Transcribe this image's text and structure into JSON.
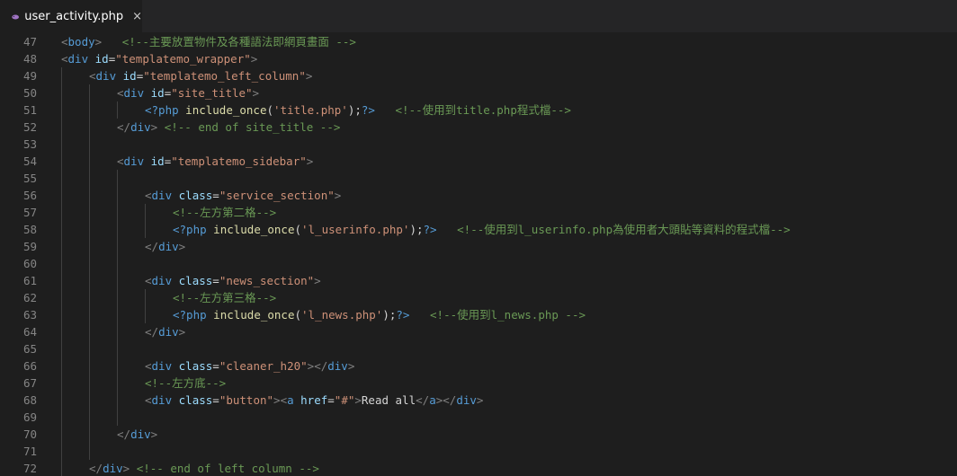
{
  "tab": {
    "filename": "user_activity.php",
    "close_glyph": "×",
    "icon": "php-elephant-icon",
    "icon_color": "#a074c4"
  },
  "colors": {
    "background": "#1e1e1e",
    "tag": "#569cd6",
    "attribute": "#9cdcfe",
    "string": "#ce9178",
    "comment": "#6a9955",
    "line_number": "#858585"
  },
  "lines": [
    {
      "n": "47",
      "indent": 0,
      "tokens": [
        [
          "p",
          "<"
        ],
        [
          "t",
          "body"
        ],
        [
          "p",
          ">"
        ],
        [
          "w",
          "   "
        ],
        [
          "c",
          "<!--主要放置物件及各種語法即網頁畫面 -->"
        ]
      ]
    },
    {
      "n": "48",
      "indent": 0,
      "tokens": [
        [
          "p",
          "<"
        ],
        [
          "t",
          "div"
        ],
        [
          "w",
          " "
        ],
        [
          "a",
          "id"
        ],
        [
          "w",
          "="
        ],
        [
          "s",
          "\"templatemo_wrapper\""
        ],
        [
          "p",
          ">"
        ]
      ]
    },
    {
      "n": "49",
      "indent": 1,
      "tokens": [
        [
          "p",
          "<"
        ],
        [
          "t",
          "div"
        ],
        [
          "w",
          " "
        ],
        [
          "a",
          "id"
        ],
        [
          "w",
          "="
        ],
        [
          "s",
          "\"templatemo_left_column\""
        ],
        [
          "p",
          ">"
        ]
      ]
    },
    {
      "n": "50",
      "indent": 2,
      "tokens": [
        [
          "p",
          "<"
        ],
        [
          "t",
          "div"
        ],
        [
          "w",
          " "
        ],
        [
          "a",
          "id"
        ],
        [
          "w",
          "="
        ],
        [
          "s",
          "\"site_title\""
        ],
        [
          "p",
          ">"
        ]
      ]
    },
    {
      "n": "51",
      "indent": 3,
      "tokens": [
        [
          "k",
          "<?php"
        ],
        [
          "w",
          " "
        ],
        [
          "f",
          "include_once"
        ],
        [
          "w",
          "("
        ],
        [
          "s",
          "'title.php'"
        ],
        [
          "w",
          ");"
        ],
        [
          "k",
          "?>"
        ],
        [
          "w",
          "   "
        ],
        [
          "c",
          "<!--使用到title.php程式檔-->"
        ]
      ]
    },
    {
      "n": "52",
      "indent": 2,
      "tokens": [
        [
          "p",
          "</"
        ],
        [
          "t",
          "div"
        ],
        [
          "p",
          ">"
        ],
        [
          "w",
          " "
        ],
        [
          "c",
          "<!-- end of site_title -->"
        ]
      ]
    },
    {
      "n": "53",
      "indent": 2,
      "tokens": []
    },
    {
      "n": "54",
      "indent": 2,
      "tokens": [
        [
          "p",
          "<"
        ],
        [
          "t",
          "div"
        ],
        [
          "w",
          " "
        ],
        [
          "a",
          "id"
        ],
        [
          "w",
          "="
        ],
        [
          "s",
          "\"templatemo_sidebar\""
        ],
        [
          "p",
          ">"
        ]
      ]
    },
    {
      "n": "55",
      "indent": 3,
      "tokens": []
    },
    {
      "n": "56",
      "indent": 3,
      "tokens": [
        [
          "p",
          "<"
        ],
        [
          "t",
          "div"
        ],
        [
          "w",
          " "
        ],
        [
          "a",
          "class"
        ],
        [
          "w",
          "="
        ],
        [
          "s",
          "\"service_section\""
        ],
        [
          "p",
          ">"
        ]
      ]
    },
    {
      "n": "57",
      "indent": 4,
      "tokens": [
        [
          "c",
          "<!--左方第二格-->"
        ]
      ]
    },
    {
      "n": "58",
      "indent": 4,
      "tokens": [
        [
          "k",
          "<?php"
        ],
        [
          "w",
          " "
        ],
        [
          "f",
          "include_once"
        ],
        [
          "w",
          "("
        ],
        [
          "s",
          "'l_userinfo.php'"
        ],
        [
          "w",
          ");"
        ],
        [
          "k",
          "?>"
        ],
        [
          "w",
          "   "
        ],
        [
          "c",
          "<!--使用到l_userinfo.php為使用者大頭貼等資料的程式檔-->"
        ]
      ]
    },
    {
      "n": "59",
      "indent": 3,
      "tokens": [
        [
          "p",
          "</"
        ],
        [
          "t",
          "div"
        ],
        [
          "p",
          ">"
        ]
      ]
    },
    {
      "n": "60",
      "indent": 3,
      "tokens": []
    },
    {
      "n": "61",
      "indent": 3,
      "tokens": [
        [
          "p",
          "<"
        ],
        [
          "t",
          "div"
        ],
        [
          "w",
          " "
        ],
        [
          "a",
          "class"
        ],
        [
          "w",
          "="
        ],
        [
          "s",
          "\"news_section\""
        ],
        [
          "p",
          ">"
        ]
      ]
    },
    {
      "n": "62",
      "indent": 4,
      "tokens": [
        [
          "c",
          "<!--左方第三格-->"
        ]
      ]
    },
    {
      "n": "63",
      "indent": 4,
      "tokens": [
        [
          "k",
          "<?php"
        ],
        [
          "w",
          " "
        ],
        [
          "f",
          "include_once"
        ],
        [
          "w",
          "("
        ],
        [
          "s",
          "'l_news.php'"
        ],
        [
          "w",
          ");"
        ],
        [
          "k",
          "?>"
        ],
        [
          "w",
          "   "
        ],
        [
          "c",
          "<!--使用到l_news.php -->"
        ]
      ]
    },
    {
      "n": "64",
      "indent": 3,
      "tokens": [
        [
          "p",
          "</"
        ],
        [
          "t",
          "div"
        ],
        [
          "p",
          ">"
        ]
      ]
    },
    {
      "n": "65",
      "indent": 3,
      "tokens": []
    },
    {
      "n": "66",
      "indent": 3,
      "tokens": [
        [
          "p",
          "<"
        ],
        [
          "t",
          "div"
        ],
        [
          "w",
          " "
        ],
        [
          "a",
          "class"
        ],
        [
          "w",
          "="
        ],
        [
          "s",
          "\"cleaner_h20\""
        ],
        [
          "p",
          ">"
        ],
        [
          "p",
          "</"
        ],
        [
          "t",
          "div"
        ],
        [
          "p",
          ">"
        ]
      ]
    },
    {
      "n": "67",
      "indent": 3,
      "tokens": [
        [
          "c",
          "<!--左方底-->"
        ]
      ]
    },
    {
      "n": "68",
      "indent": 3,
      "tokens": [
        [
          "p",
          "<"
        ],
        [
          "t",
          "div"
        ],
        [
          "w",
          " "
        ],
        [
          "a",
          "class"
        ],
        [
          "w",
          "="
        ],
        [
          "s",
          "\"button\""
        ],
        [
          "p",
          ">"
        ],
        [
          "p",
          "<"
        ],
        [
          "t",
          "a"
        ],
        [
          "w",
          " "
        ],
        [
          "a",
          "href"
        ],
        [
          "w",
          "="
        ],
        [
          "s",
          "\"#\""
        ],
        [
          "p",
          ">"
        ],
        [
          "w",
          "Read all"
        ],
        [
          "p",
          "</"
        ],
        [
          "t",
          "a"
        ],
        [
          "p",
          ">"
        ],
        [
          "p",
          "</"
        ],
        [
          "t",
          "div"
        ],
        [
          "p",
          ">"
        ]
      ]
    },
    {
      "n": "69",
      "indent": 3,
      "tokens": []
    },
    {
      "n": "70",
      "indent": 2,
      "tokens": [
        [
          "p",
          "</"
        ],
        [
          "t",
          "div"
        ],
        [
          "p",
          ">"
        ]
      ]
    },
    {
      "n": "71",
      "indent": 2,
      "tokens": []
    },
    {
      "n": "72",
      "indent": 1,
      "tokens": [
        [
          "p",
          "</"
        ],
        [
          "t",
          "div"
        ],
        [
          "p",
          ">"
        ],
        [
          "w",
          " "
        ],
        [
          "c",
          "<!-- end of left column -->"
        ]
      ]
    }
  ]
}
